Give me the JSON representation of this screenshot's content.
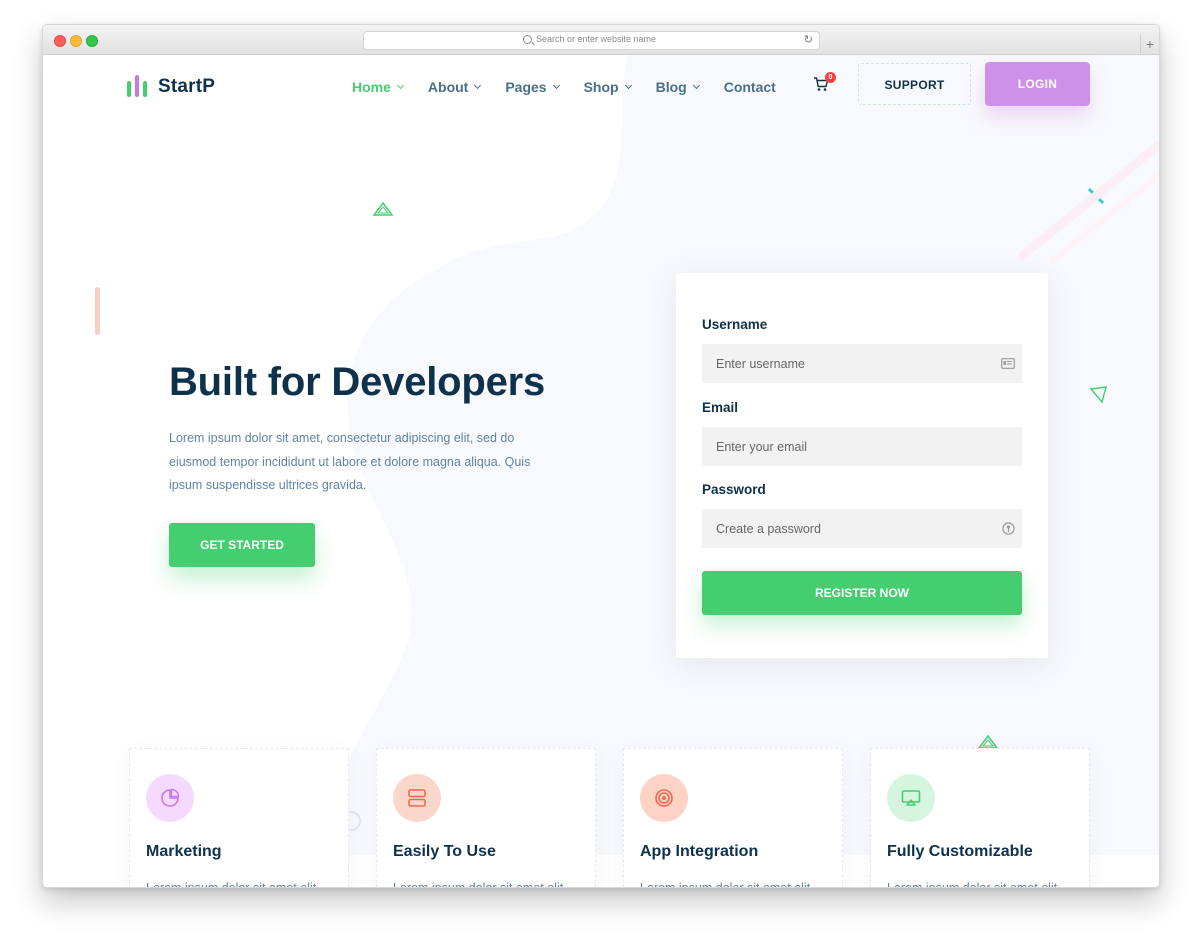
{
  "browser": {
    "url_placeholder": "Search or enter website name",
    "new_tab_label": "+"
  },
  "brand": {
    "name": "StartP",
    "logo_colors": [
      "#44ce6f",
      "#c679e3",
      "#44ce6f"
    ]
  },
  "nav": {
    "items": [
      {
        "label": "Home",
        "active": true,
        "has_dropdown": true
      },
      {
        "label": "About",
        "active": false,
        "has_dropdown": true
      },
      {
        "label": "Pages",
        "active": false,
        "has_dropdown": true
      },
      {
        "label": "Shop",
        "active": false,
        "has_dropdown": true
      },
      {
        "label": "Blog",
        "active": false,
        "has_dropdown": true
      },
      {
        "label": "Contact",
        "active": false,
        "has_dropdown": false
      }
    ],
    "cart_count": "0",
    "support_label": "SUPPORT",
    "login_label": "LOGIN"
  },
  "hero": {
    "title": "Built for Developers",
    "text": "Lorem ipsum dolor sit amet, consectetur adipiscing elit, sed do eiusmod tempor incididunt ut labore et dolore magna aliqua. Quis ipsum suspendisse ultrices gravida.",
    "cta_label": "GET STARTED"
  },
  "form": {
    "username_label": "Username",
    "username_placeholder": "Enter username",
    "email_label": "Email",
    "email_placeholder": "Enter your email",
    "password_label": "Password",
    "password_placeholder": "Create a password",
    "submit_label": "REGISTER NOW"
  },
  "features": [
    {
      "title": "Marketing",
      "text": "Lorem ipsum dolor sit amet elit, adipiscing, sed do",
      "icon": "pie-chart-icon",
      "bg": "#f5d9ff",
      "fg": "#c679e3"
    },
    {
      "title": "Easily To Use",
      "text": "Lorem ipsum dolor sit amet elit, adipiscing, sed do",
      "icon": "server-icon",
      "bg": "#fbd6cb",
      "fg": "#f28e6f"
    },
    {
      "title": "App Integration",
      "text": "Lorem ipsum dolor sit amet elit, adipiscing, sed do",
      "icon": "target-icon",
      "bg": "#fcd3c5",
      "fg": "#f0694e"
    },
    {
      "title": "Fully Customizable",
      "text": "Lorem ipsum dolor sit amet elit, adipiscing, sed do",
      "icon": "monitor-icon",
      "bg": "#d6f5df",
      "fg": "#44ce6f"
    }
  ],
  "colors": {
    "accent": "#44ce6f",
    "login": "#cd91e9",
    "heading": "#0e314c",
    "body_text": "#6084a4"
  }
}
